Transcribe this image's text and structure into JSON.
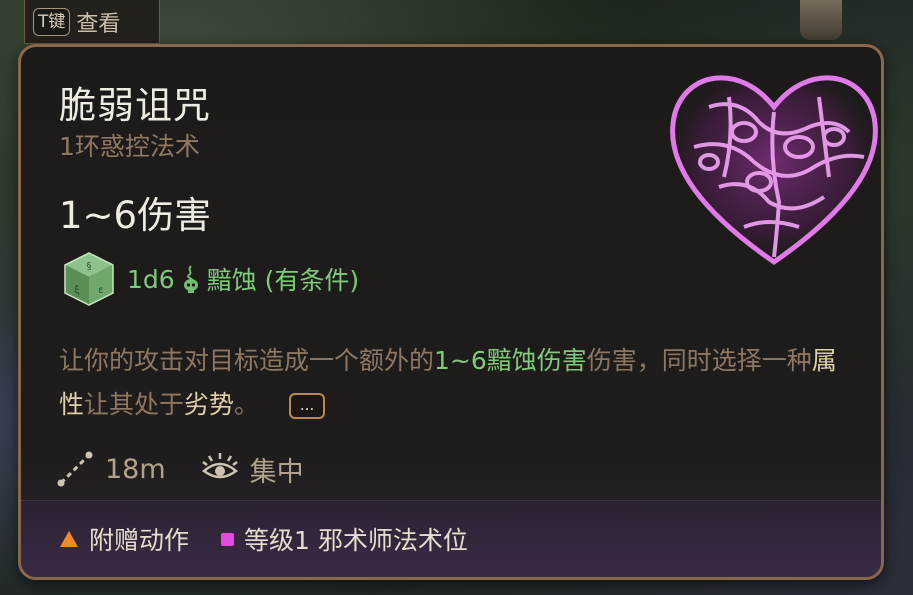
{
  "hint": {
    "key": "T键",
    "label": "查看"
  },
  "spell": {
    "name": "脆弱诅咒",
    "school": "1环惑控法术",
    "damage_headline": "1~6伤害",
    "roll": {
      "dice": "1d6",
      "damage_type": "黯蚀 (有条件)",
      "icon": "necrotic-skull-icon"
    },
    "description": {
      "part1": "让你的攻击对目标造成一个额外的",
      "hl1": "1~6黯蚀伤害",
      "part2": "伤害，同时选择一种",
      "hl2": "属性",
      "part3": "让其处于",
      "hl3": "劣势",
      "part4": "。",
      "more": "..."
    },
    "range": "18m",
    "concentration": "集中",
    "cost": {
      "action": "附赠动作",
      "slot": "等级1 邪术师法术位"
    }
  },
  "colors": {
    "accent_green": "#7dcb7a",
    "border_bronze": "#87684a",
    "slot_magenta": "#e04be0",
    "action_orange": "#f08a2a"
  }
}
